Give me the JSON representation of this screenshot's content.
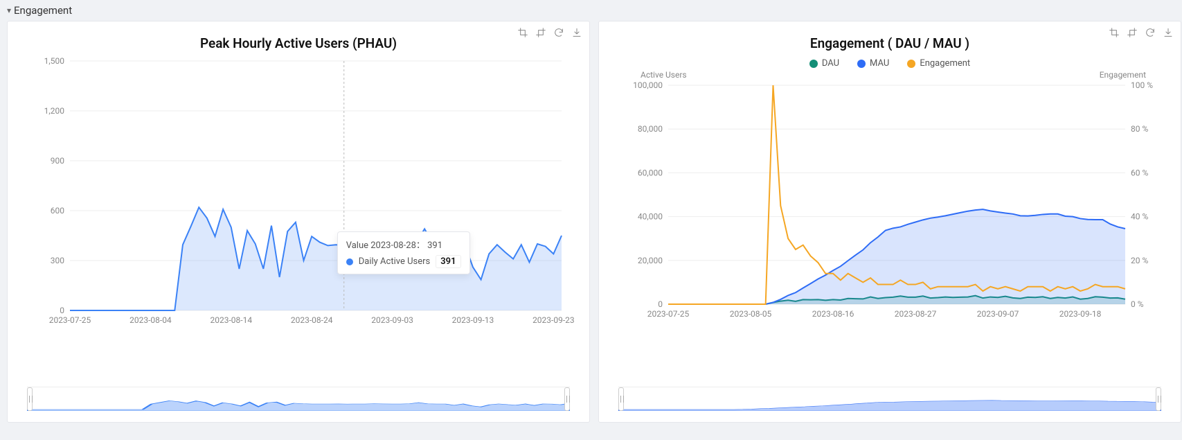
{
  "section_title": "Engagement",
  "panels": {
    "left": {
      "title": "Peak Hourly Active Users (PHAU)",
      "toolbar": [
        "crop",
        "reset-zoom",
        "refresh",
        "download"
      ],
      "tooltip": {
        "header_label": "Value",
        "date": "2023-08-28",
        "value_text": "391",
        "series_label": "Daily Active Users",
        "series_value": "391",
        "dot_color": "#3b82f6"
      }
    },
    "right": {
      "title": "Engagement ( DAU / MAU )",
      "toolbar": [
        "crop",
        "reset-zoom",
        "refresh",
        "download"
      ],
      "legend": [
        {
          "label": "DAU",
          "color": "#148f77"
        },
        {
          "label": "MAU",
          "color": "#2e6cf6"
        },
        {
          "label": "Engagement",
          "color": "#f5a623"
        }
      ],
      "left_axis_title": "Active Users",
      "right_axis_title": "Engagement"
    }
  },
  "chart_data": [
    {
      "id": "phau",
      "type": "area",
      "title": "Peak Hourly Active Users (PHAU)",
      "ylabel": "",
      "ylim": [
        0,
        1500
      ],
      "yticks": [
        0,
        300,
        600,
        900,
        1200,
        1500
      ],
      "x": [
        "2023-07-25",
        "2023-07-26",
        "2023-07-27",
        "2023-07-28",
        "2023-07-29",
        "2023-07-30",
        "2023-07-31",
        "2023-08-01",
        "2023-08-02",
        "2023-08-03",
        "2023-08-04",
        "2023-08-05",
        "2023-08-06",
        "2023-08-07",
        "2023-08-08",
        "2023-08-09",
        "2023-08-10",
        "2023-08-11",
        "2023-08-12",
        "2023-08-13",
        "2023-08-14",
        "2023-08-15",
        "2023-08-16",
        "2023-08-17",
        "2023-08-18",
        "2023-08-19",
        "2023-08-20",
        "2023-08-21",
        "2023-08-22",
        "2023-08-23",
        "2023-08-24",
        "2023-08-25",
        "2023-08-26",
        "2023-08-27",
        "2023-08-28",
        "2023-08-29",
        "2023-08-30",
        "2023-08-31",
        "2023-09-01",
        "2023-09-02",
        "2023-09-03",
        "2023-09-04",
        "2023-09-05",
        "2023-09-06",
        "2023-09-07",
        "2023-09-08",
        "2023-09-09",
        "2023-09-10",
        "2023-09-11",
        "2023-09-12",
        "2023-09-13",
        "2023-09-14",
        "2023-09-15",
        "2023-09-16",
        "2023-09-17",
        "2023-09-18",
        "2023-09-19",
        "2023-09-20",
        "2023-09-21",
        "2023-09-22",
        "2023-09-23",
        "2023-09-24"
      ],
      "xticks": [
        "2023-07-25",
        "2023-08-04",
        "2023-08-14",
        "2023-08-24",
        "2023-09-03",
        "2023-09-13",
        "2023-09-23"
      ],
      "series": [
        {
          "name": "Daily Active Users",
          "color": "#3b82f6",
          "values": [
            0,
            0,
            0,
            0,
            0,
            0,
            0,
            0,
            0,
            0,
            0,
            0,
            0,
            0,
            395,
            505,
            620,
            555,
            445,
            608,
            500,
            250,
            480,
            400,
            250,
            510,
            200,
            475,
            530,
            300,
            445,
            410,
            390,
            395,
            391,
            400,
            385,
            395,
            395,
            410,
            400,
            390,
            395,
            410,
            490,
            405,
            395,
            395,
            300,
            395,
            260,
            185,
            340,
            395,
            350,
            310,
            395,
            290,
            400,
            385,
            340,
            450
          ]
        }
      ]
    },
    {
      "id": "engagement",
      "type": "line",
      "title": "Engagement ( DAU / MAU )",
      "ylabel_left": "Active Users",
      "ylabel_right": "Engagement",
      "ylim_left": [
        0,
        100000
      ],
      "ylim_right_pct": [
        0,
        100
      ],
      "yticks_left": [
        0,
        20000,
        40000,
        60000,
        80000,
        100000
      ],
      "yticks_right": [
        "0 %",
        "20 %",
        "40 %",
        "60 %",
        "80 %",
        "100 %"
      ],
      "x": [
        "2023-07-25",
        "2023-07-26",
        "2023-07-27",
        "2023-07-28",
        "2023-07-29",
        "2023-07-30",
        "2023-07-31",
        "2023-08-01",
        "2023-08-02",
        "2023-08-03",
        "2023-08-04",
        "2023-08-05",
        "2023-08-06",
        "2023-08-07",
        "2023-08-08",
        "2023-08-09",
        "2023-08-10",
        "2023-08-11",
        "2023-08-12",
        "2023-08-13",
        "2023-08-14",
        "2023-08-15",
        "2023-08-16",
        "2023-08-17",
        "2023-08-18",
        "2023-08-19",
        "2023-08-20",
        "2023-08-21",
        "2023-08-22",
        "2023-08-23",
        "2023-08-24",
        "2023-08-25",
        "2023-08-26",
        "2023-08-27",
        "2023-08-28",
        "2023-08-29",
        "2023-08-30",
        "2023-08-31",
        "2023-09-01",
        "2023-09-02",
        "2023-09-03",
        "2023-09-04",
        "2023-09-05",
        "2023-09-06",
        "2023-09-07",
        "2023-09-08",
        "2023-09-09",
        "2023-09-10",
        "2023-09-11",
        "2023-09-12",
        "2023-09-13",
        "2023-09-14",
        "2023-09-15",
        "2023-09-16",
        "2023-09-17",
        "2023-09-18",
        "2023-09-19",
        "2023-09-20",
        "2023-09-21",
        "2023-09-22",
        "2023-09-23",
        "2023-09-24"
      ],
      "xticks": [
        "2023-07-25",
        "2023-08-05",
        "2023-08-16",
        "2023-08-27",
        "2023-09-07",
        "2023-09-18"
      ],
      "series": [
        {
          "name": "DAU",
          "axis": "left",
          "color": "#148f77",
          "values": [
            0,
            0,
            0,
            0,
            0,
            0,
            0,
            0,
            0,
            0,
            0,
            0,
            0,
            0,
            800,
            1400,
            1800,
            1300,
            2100,
            2000,
            2100,
            1800,
            2100,
            1900,
            2600,
            2500,
            2400,
            3300,
            2600,
            3000,
            3200,
            3700,
            3200,
            3200,
            3700,
            2800,
            3000,
            3300,
            3100,
            3200,
            3300,
            3900,
            2800,
            3300,
            3100,
            3600,
            2900,
            2600,
            3200,
            3100,
            3400,
            2600,
            3100,
            2800,
            3300,
            2300,
            2600,
            3400,
            3200,
            2800,
            2900,
            2300
          ]
        },
        {
          "name": "MAU",
          "axis": "left",
          "color": "#2e6cf6",
          "values": [
            0,
            0,
            0,
            0,
            0,
            0,
            0,
            0,
            0,
            0,
            0,
            0,
            0,
            0,
            800,
            2200,
            4000,
            5300,
            7400,
            9400,
            11500,
            13300,
            15400,
            17300,
            19900,
            22400,
            24800,
            28100,
            30700,
            33700,
            34700,
            35300,
            36500,
            37500,
            38500,
            39300,
            39800,
            40400,
            41100,
            41800,
            42500,
            43000,
            43300,
            42600,
            42100,
            41600,
            41200,
            40400,
            40300,
            40600,
            41000,
            41200,
            41200,
            40200,
            40000,
            39100,
            38700,
            38600,
            38600,
            36600,
            35300,
            34500
          ]
        },
        {
          "name": "Engagement",
          "axis": "right_pct",
          "color": "#f5a623",
          "values": [
            0,
            0,
            0,
            0,
            0,
            0,
            0,
            0,
            0,
            0,
            0,
            0,
            0,
            0,
            100,
            45,
            30,
            25,
            27,
            22,
            19,
            14,
            14,
            11,
            14,
            12,
            10,
            12,
            9,
            9,
            9,
            11,
            9,
            9,
            10,
            7,
            8,
            8,
            8,
            8,
            8,
            9,
            6,
            8,
            7,
            8,
            7,
            6,
            8,
            8,
            8,
            6,
            8,
            7,
            8,
            6,
            7,
            9,
            8,
            8,
            8,
            7
          ]
        }
      ]
    }
  ]
}
